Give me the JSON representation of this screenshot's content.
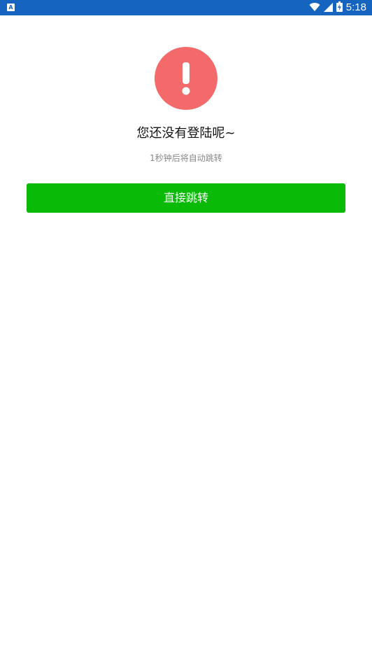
{
  "status_bar": {
    "app_badge": "A",
    "time": "5:18",
    "icons": [
      "wifi-icon",
      "cell-signal-icon",
      "battery-charging-icon"
    ],
    "background_color": "#1565c0"
  },
  "notice": {
    "icon": "exclamation-icon",
    "icon_color": "#f46a6a",
    "title": "您还没有登陆呢~",
    "subtitle": "1秒钟后将自动跳转"
  },
  "actions": {
    "jump_label": "直接跳转",
    "jump_color": "#09bb07"
  }
}
